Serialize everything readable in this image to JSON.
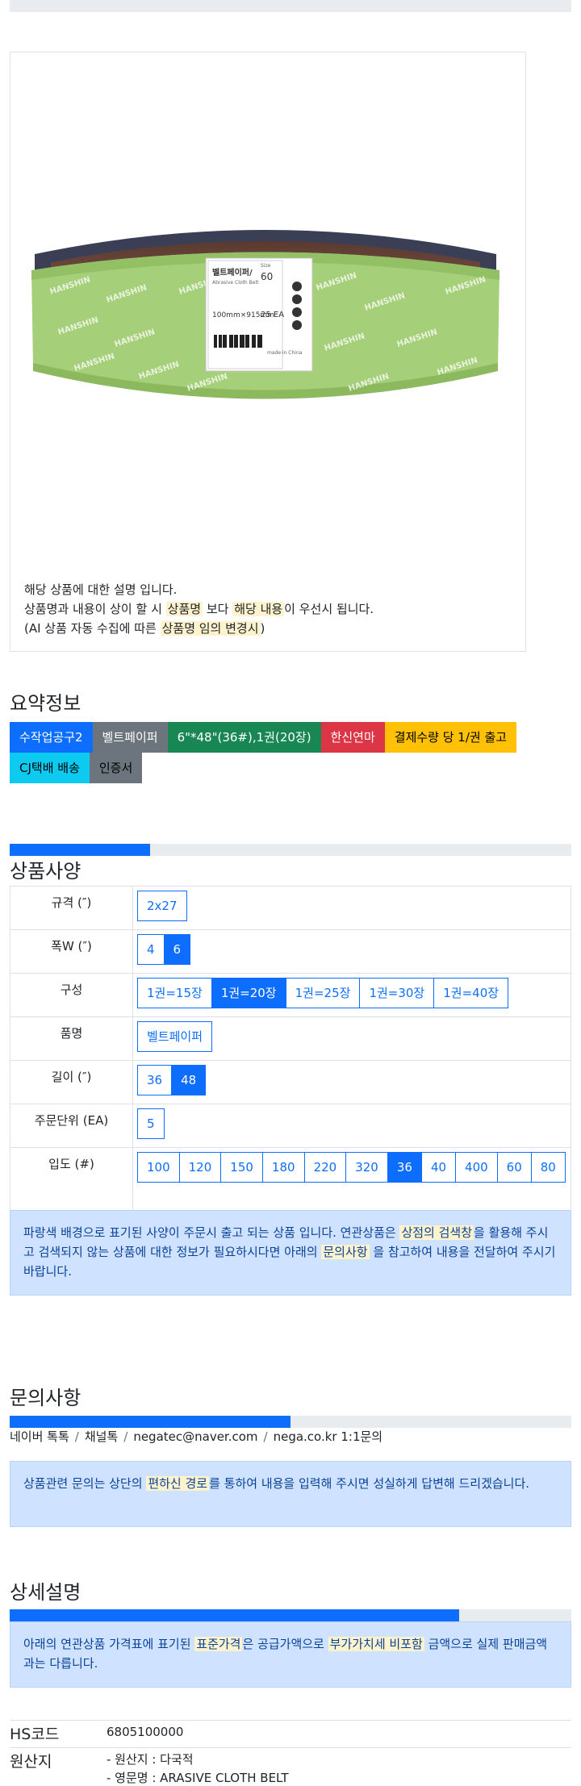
{
  "product_image": {
    "brand": "HANSHIN",
    "label_title": "벨트페이퍼/",
    "label_sub": "Abrasive Cloth Belt",
    "label_grit_head": "Size",
    "label_grit": "60",
    "label_size": "100mm×915mm",
    "label_qty": "25 EA",
    "label_origin": "made in China"
  },
  "caption": {
    "line1": "해당 상품에 대한 설명 입니다.",
    "line2_a": "상품명과 내용이 상이 할 시 ",
    "line2_hl1": "상품명",
    "line2_b": " 보다 ",
    "line2_hl2": "해당 내용",
    "line2_c": "이 우선시 됩니다.",
    "line3_a": "(AI 상품 자동 수집에 따른 ",
    "line3_hl": "상품명 임의 변경시",
    "line3_b": ")"
  },
  "summary": {
    "title": "요약정보",
    "badges_row1": [
      {
        "label": "수작업공구2",
        "color": "#0d6efd",
        "text": "#ffffff"
      },
      {
        "label": "벨트페이퍼",
        "color": "#6c757d",
        "text": "#ffffff"
      },
      {
        "label": "6\"*48\"(36#),1권(20장)",
        "color": "#198754",
        "text": "#ffffff"
      },
      {
        "label": "한신연마",
        "color": "#dc3545",
        "text": "#ffffff"
      },
      {
        "label": "결제수량 당 1/권 출고",
        "color": "#ffc107",
        "text": "#000000"
      }
    ],
    "badges_row2": [
      {
        "label": "CJ택배 배송",
        "color": "#0dcaf0",
        "text": "#000000"
      },
      {
        "label": "인증서",
        "color": "#6c757d",
        "text": "#000000"
      }
    ]
  },
  "spec": {
    "title": "상품사양",
    "progress": 0.25,
    "rows": [
      {
        "label": "규격 (″)",
        "options": [
          {
            "v": "2x27",
            "sel": false
          }
        ]
      },
      {
        "label": "폭W (″)",
        "options": [
          {
            "v": "4",
            "sel": false
          },
          {
            "v": "6",
            "sel": true
          }
        ]
      },
      {
        "label": "구성",
        "options": [
          {
            "v": "1권=15장",
            "sel": false
          },
          {
            "v": "1권=20장",
            "sel": true
          },
          {
            "v": "1권=25장",
            "sel": false
          },
          {
            "v": "1권=30장",
            "sel": false
          },
          {
            "v": "1권=40장",
            "sel": false
          }
        ]
      },
      {
        "label": "품명",
        "options": [
          {
            "v": "벨트페이퍼",
            "sel": false
          }
        ]
      },
      {
        "label": "길이 (″)",
        "options": [
          {
            "v": "36",
            "sel": false
          },
          {
            "v": "48",
            "sel": true
          }
        ]
      },
      {
        "label": "주문단위 (EA)",
        "options": [
          {
            "v": "5",
            "sel": false
          }
        ]
      },
      {
        "label": "입도 (#)",
        "options": [
          {
            "v": "100",
            "sel": false
          },
          {
            "v": "120",
            "sel": false
          },
          {
            "v": "150",
            "sel": false
          },
          {
            "v": "180",
            "sel": false
          },
          {
            "v": "220",
            "sel": false
          },
          {
            "v": "320",
            "sel": false
          },
          {
            "v": "36",
            "sel": true
          },
          {
            "v": "40",
            "sel": false
          },
          {
            "v": "400",
            "sel": false
          },
          {
            "v": "60",
            "sel": false
          },
          {
            "v": "80",
            "sel": false
          }
        ]
      }
    ],
    "notice_a": "파랑색 배경으로 표기된 사양이 주문시 출고 되는 상품 입니다. 연관상품은 ",
    "notice_hl1": "상점의 검색창",
    "notice_b": "을 활용해 주시고 검색되지 않는 상품에 대한 정보가 필요하시다면 아래의 ",
    "notice_hl2": "문의사항",
    "notice_c": " 을 참고하여 내용을 전달하여 주시기 바랍니다."
  },
  "inquiry": {
    "title": "문의사항",
    "progress": 0.5,
    "contacts": [
      "네이버 톡톡",
      "채널톡",
      "negatec@naver.com",
      "nega.co.kr 1:1문의"
    ],
    "notice_a": "상품관련 문의는 상단의 ",
    "notice_hl": "편하신 경로",
    "notice_b": "를 통하여 내용을 입력해 주시면 성실하게 답변해 드리겠습니다."
  },
  "detail": {
    "title": "상세설명",
    "progress": 0.8,
    "notice_a": "아래의 연관상품 가격표에 표기된 ",
    "notice_hl1": "표준가격",
    "notice_b": "은 공급가액으로 ",
    "notice_hl2": "부가가치세 비포함",
    "notice_c": " 금액으로 실제 판매금액과는 다릅니다.",
    "hs_label": "HS코드",
    "hs_value": "6805100000",
    "origin_label": "원산지",
    "origin_line1": "- 원산지 : 다국적",
    "origin_line2": "- 영문명 : ARASIVE CLOTH BELT"
  }
}
